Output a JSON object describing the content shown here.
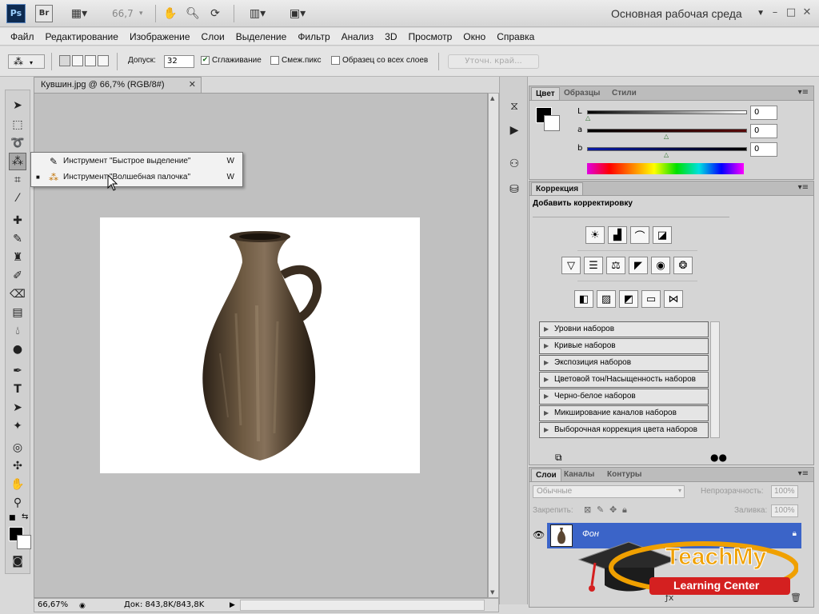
{
  "appbar": {
    "ps_logo": "Ps",
    "br_logo": "Br",
    "zoom": "66,7",
    "workspace": "Основная рабочая среда",
    "window_buttons": [
      "–",
      "□",
      "✕"
    ]
  },
  "menubar": {
    "items": [
      "Файл",
      "Редактирование",
      "Изображение",
      "Слои",
      "Выделение",
      "Фильтр",
      "Анализ",
      "3D",
      "Просмотр",
      "Окно",
      "Справка"
    ]
  },
  "options": {
    "tolerance_label": "Допуск:",
    "tolerance_value": "32",
    "antialias_label": "Сглаживание",
    "antialias_checked": true,
    "contiguous_label": "Смеж.пикс",
    "contiguous_checked": false,
    "sample_all_label": "Образец со всех слоев",
    "sample_all_checked": false,
    "refine_edge_label": "Уточн. край..."
  },
  "flyout": {
    "items": [
      {
        "label": "Инструмент \"Быстрое выделение\"",
        "shortcut": "W",
        "selected": false
      },
      {
        "label": "Инструмент \"Волшебная палочка\"",
        "shortcut": "W",
        "selected": true
      }
    ],
    "bullet": "■"
  },
  "document": {
    "tab_title": "Кувшин.jpg @ 66,7% (RGB/8#)",
    "close": "✕",
    "status_zoom": "66,67%",
    "status_doc": "Док: 843,8K/843,8K"
  },
  "color_panel": {
    "tabs": [
      "Цвет",
      "Образцы",
      "Стили"
    ],
    "channels": [
      {
        "label": "L",
        "value": "0"
      },
      {
        "label": "a",
        "value": "0"
      },
      {
        "label": "b",
        "value": "0"
      }
    ]
  },
  "adjustments_panel": {
    "tabs": [
      "Коррекция"
    ],
    "heading": "Добавить корректировку",
    "presets": [
      "Уровни наборов",
      "Кривые наборов",
      "Экспозиция наборов",
      "Цветовой тон/Насыщенность наборов",
      "Черно-белое наборов",
      "Микширование каналов наборов",
      "Выборочная коррекция цвета наборов"
    ]
  },
  "layers_panel": {
    "tabs": [
      "Слои",
      "Каналы",
      "Контуры"
    ],
    "blend_mode": "Обычные",
    "opacity_label": "Непрозрачность:",
    "opacity_value": "100%",
    "lock_label": "Закрепить:",
    "fill_label": "Заливка:",
    "fill_value": "100%",
    "layers": [
      {
        "name": "Фон",
        "locked": true,
        "visible": true
      }
    ]
  },
  "watermark": {
    "brand": "TeachMy",
    "subtitle": "Learning Center"
  },
  "colors": {
    "layer_selected": "#3b64c8",
    "watermark_orange": "#f0a000",
    "watermark_red": "#d42020",
    "foreground": "#000000",
    "background": "#ffffff"
  }
}
